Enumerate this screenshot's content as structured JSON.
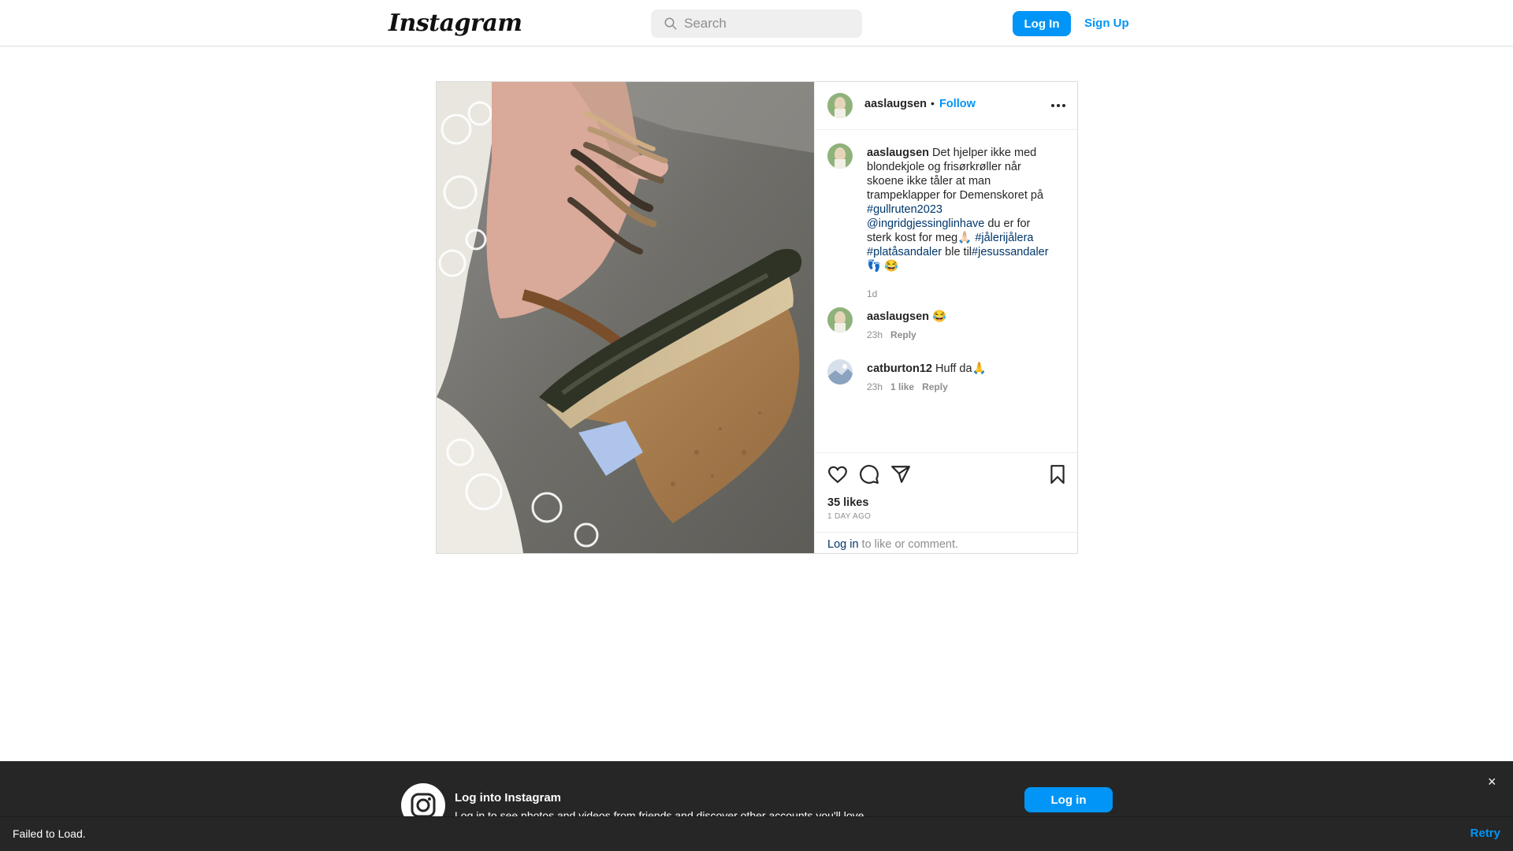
{
  "header": {
    "logo_text": "Instagram",
    "search_placeholder": "Search",
    "login_label": "Log In",
    "signup_label": "Sign Up"
  },
  "post": {
    "username": "aaslaugsen",
    "follow_label": "Follow",
    "caption": {
      "username": "aaslaugsen",
      "parts": [
        {
          "type": "text",
          "value": " Det hjelper ikke med blondekjole og frisørkrøller når skoene ikke tåler at man trampeklapper for Demenskoret på "
        },
        {
          "type": "tag",
          "value": "#gullruten2023"
        },
        {
          "type": "text",
          "value": " "
        },
        {
          "type": "tag",
          "value": "@ingridgjessinglinhave"
        },
        {
          "type": "text",
          "value": " du er for sterk kost for meg🙏🏻 "
        },
        {
          "type": "tag",
          "value": "#jålerijålera"
        },
        {
          "type": "text",
          "value": " "
        },
        {
          "type": "tag",
          "value": "#platåsandaler"
        },
        {
          "type": "text",
          "value": " ble til"
        },
        {
          "type": "tag",
          "value": "#jesussandaler"
        },
        {
          "type": "text",
          "value": "👣 😂"
        }
      ],
      "time": "1d"
    },
    "comments": [
      {
        "username": "aaslaugsen",
        "text": " 😂",
        "time": "23h",
        "likes": "",
        "reply_label": "Reply"
      },
      {
        "username": "catburton12",
        "text": " Huff da🙏",
        "time": "23h",
        "likes": "1 like",
        "reply_label": "Reply"
      }
    ],
    "likes_text": "35 likes",
    "time_ago": "1 DAY AGO",
    "login_link": "Log in",
    "login_suffix": " to like or comment."
  },
  "overlay": {
    "title": "Log into Instagram",
    "subtitle": "Log in to see photos and videos from friends and discover other accounts you'll love.",
    "login_label": "Log in",
    "close_symbol": "×"
  },
  "error_bar": {
    "message": "Failed to Load.",
    "retry_label": "Retry"
  },
  "colors": {
    "accent": "#0095f6",
    "hashtag": "#00376b",
    "muted": "#8e8e8e",
    "overlay_bg": "#262626"
  }
}
